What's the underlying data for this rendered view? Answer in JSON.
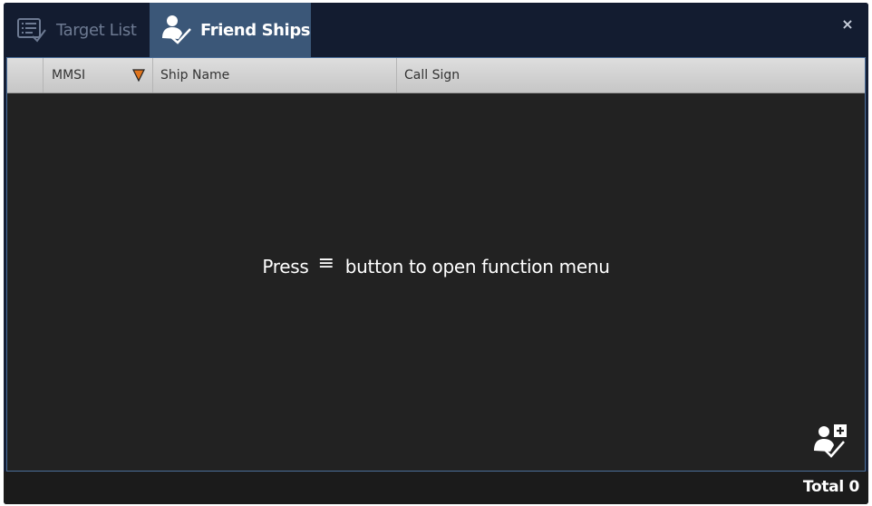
{
  "tabs": [
    {
      "label": "Target List",
      "icon": "target-list-icon",
      "active": false
    },
    {
      "label": "Friend Ships",
      "icon": "friend-ship-icon",
      "active": true
    }
  ],
  "window": {
    "close_icon": "close-icon",
    "close_glyph": "×"
  },
  "table": {
    "columns": [
      {
        "label": ""
      },
      {
        "label": "MMSI",
        "sort": "descending",
        "sort_color": "#e0741c"
      },
      {
        "label": "Ship Name"
      },
      {
        "label": "Call Sign"
      }
    ],
    "rows": []
  },
  "empty_message": {
    "before": "Press",
    "glyph": "≡",
    "after": "button to open function menu"
  },
  "actions": {
    "add_friend_icon": "add-friend-icon"
  },
  "footer": {
    "total_label": "Total 0"
  },
  "colors": {
    "active_tab": "#3b5778",
    "titlebar": "#131c30",
    "panel_border": "#4b6f9a",
    "list_background": "#222222"
  }
}
